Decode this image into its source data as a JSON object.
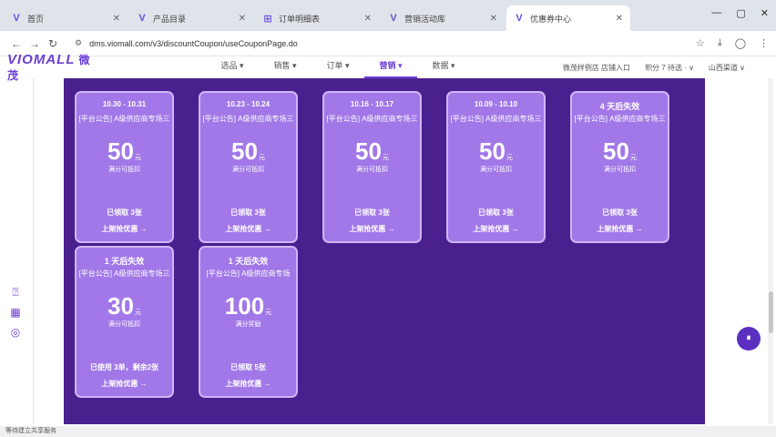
{
  "browser": {
    "tabs": [
      {
        "icon": "V",
        "label": "首页"
      },
      {
        "icon": "V",
        "label": "产品目录"
      },
      {
        "icon": "⊞",
        "label": "订单明细表"
      },
      {
        "icon": "V",
        "label": "营销活动库"
      },
      {
        "icon": "V",
        "label": "优惠券中心"
      }
    ],
    "url": "dms.viomall.com/v3/discountCoupon/useCouponPage.do"
  },
  "app": {
    "logo": "VIOMALL",
    "logo_cn": "微茂",
    "nav": [
      "选品",
      "销售",
      "订单",
      "营销",
      "数据"
    ],
    "nav_active_index": 3,
    "store": "微茂样例店 店铺入口",
    "points": "积分 7 待选 · ∨",
    "user": "山西渠道 ∨"
  },
  "coupons": [
    {
      "period": "10.30 - 10.31",
      "desc": "[平台公告] A级供应商专场三",
      "amount": "50",
      "unit": "元",
      "sub": "满分可抵扣",
      "status": "已领取 3张",
      "action": "上架抢优惠 →"
    },
    {
      "period": "10.23 - 10.24",
      "desc": "[平台公告] A级供应商专场三",
      "amount": "50",
      "unit": "元",
      "sub": "满分可抵扣",
      "status": "已领取 3张",
      "action": "上架抢优惠 →"
    },
    {
      "period": "10.16 - 10.17",
      "desc": "[平台公告] A级供应商专场三",
      "amount": "50",
      "unit": "元",
      "sub": "满分可抵扣",
      "status": "已领取 3张",
      "action": "上架抢优惠 →"
    },
    {
      "period": "10.09 - 10.10",
      "desc": "[平台公告] A级供应商专场三",
      "amount": "50",
      "unit": "元",
      "sub": "满分可抵扣",
      "status": "已领取 3张",
      "action": "上架抢优惠 →"
    },
    {
      "period": "4 天后失效",
      "desc": "[平台公告] A级供应商专场三",
      "amount": "50",
      "unit": "元",
      "sub": "满分可抵扣",
      "status": "已领取 3张",
      "action": "上架抢优惠 →"
    },
    {
      "period": "1 天后失效",
      "desc": "[平台公告] A级供应商专场三",
      "amount": "30",
      "unit": "元",
      "sub": "满分可抵扣",
      "status": "已使用 3单，剩余2张",
      "action": "上架抢优惠 →"
    },
    {
      "period": "1 天后失效",
      "desc": "[平台公告] A级供应商专场",
      "amount": "100",
      "unit": "元",
      "sub": "满分奖励",
      "status": "已领取 5张",
      "action": "上架抢优惠 →"
    }
  ],
  "statusbar": "等待建立共享服务"
}
